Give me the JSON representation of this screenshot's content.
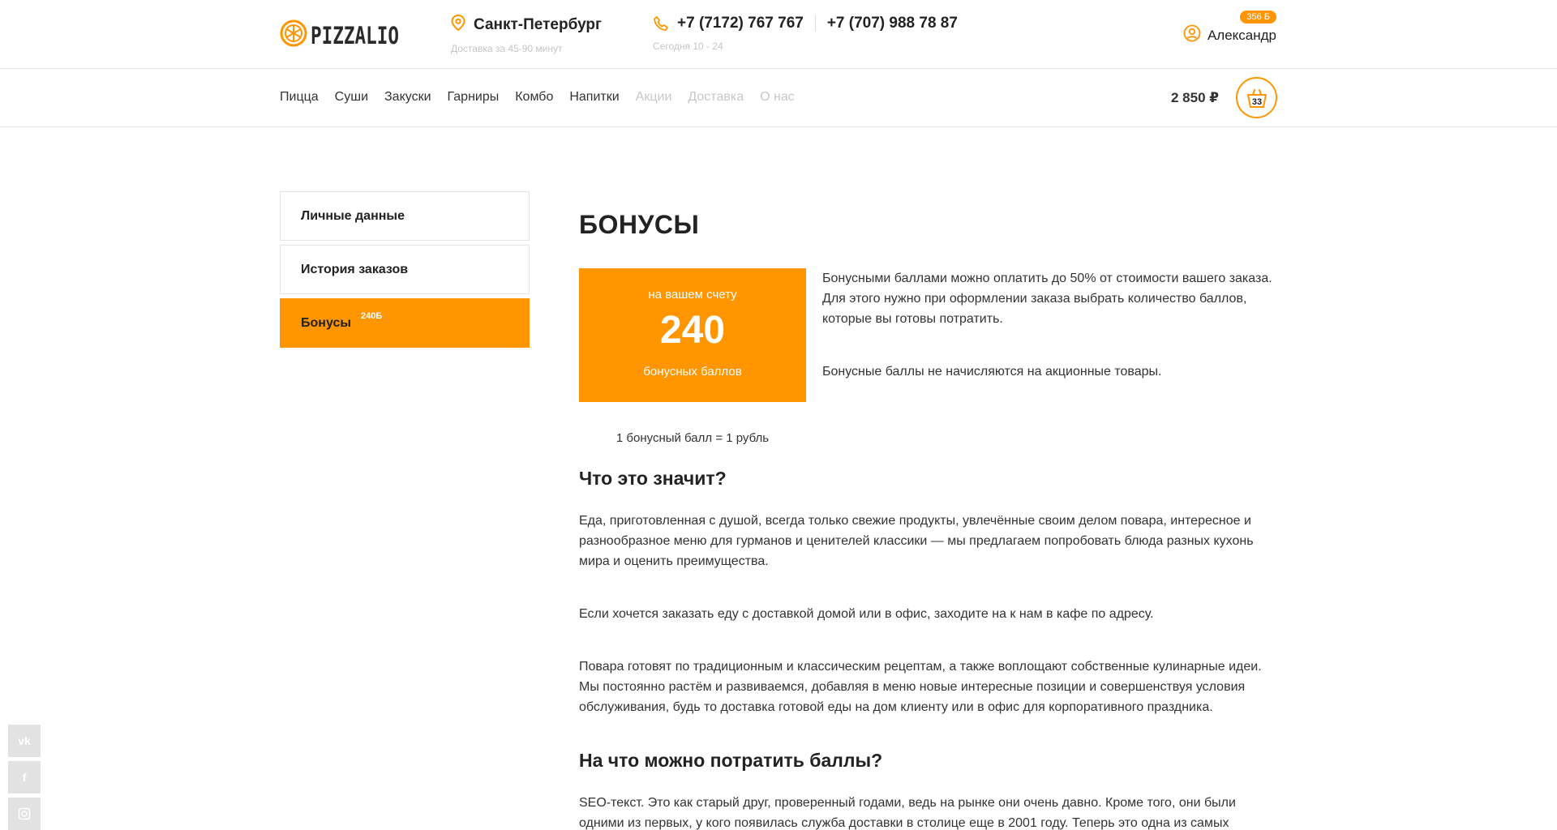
{
  "header": {
    "logo_text": "PIZZALIO",
    "city": "Санкт-Петербург",
    "delivery_note": "Доставка за 45-90 минут",
    "phones": [
      "+7 (7172) 767 767",
      "+7 (707) 988 78 87"
    ],
    "hours": "Сегодня 10 - 24",
    "user_name": "Александр",
    "user_badge": "356 Б"
  },
  "nav": {
    "items": [
      "Пицца",
      "Суши",
      "Закуски",
      "Гарниры",
      "Комбо",
      "Напитки"
    ],
    "muted_items": [
      "Акции",
      "Доставка",
      "О нас"
    ],
    "cart_total": "2 850 ₽",
    "cart_count": "33"
  },
  "sidebar": {
    "items": [
      "Личные данные",
      "История заказов",
      "Бонусы"
    ],
    "bonus_badge": "240Б"
  },
  "main": {
    "title": "БОНУСЫ",
    "bonus_top": "на вашем счету",
    "bonus_value": "240",
    "bonus_bottom": "бонусных баллов",
    "bonus_rate": "1 бонусный балл = 1 рубль",
    "info_1": "Бонусными баллами можно оплатить до 50% от стоимости вашего заказа. Для этого нужно при оформлении заказа выбрать количество баллов, которые вы готовы потратить.",
    "info_2": "Бонусные баллы не начисляются на акционные товары.",
    "h2_1": "Что это значит?",
    "p_1": "Еда, приготовленная с душой, всегда только свежие продукты, увлечённые своим делом повара, интересное и разнообразное меню для гурманов и ценителей классики — мы предлагаем попробовать блюда разных кухонь мира и оценить преимущества.",
    "p_2": "Если хочется заказать еду с доставкой домой или в офис, заходите на к нам в кафе по адресу.",
    "p_3": "Повара готовят по традиционным и классическим рецептам, а также воплощают собственные кулинарные идеи. Мы постоянно растём и развиваемся, добавляя в меню новые интересные позиции и совершенствуя условия обслуживания, будь то доставка готовой еды на дом клиенту или в офис для корпоративного праздника.",
    "h2_2": "На что можно потратить баллы?",
    "p_4": "SEO-текст. Это как старый друг, проверенный годами, ведь на рынке они очень давно. Кроме того, они были одними из первых, у кого появилась служба доставки в столице еще в 2001 году. Теперь это одна из самых больших"
  },
  "social": {
    "vk": "vk",
    "fb": "f",
    "ig": "ig"
  },
  "colors": {
    "accent": "#ff9500",
    "muted": "#c8c8c8"
  }
}
